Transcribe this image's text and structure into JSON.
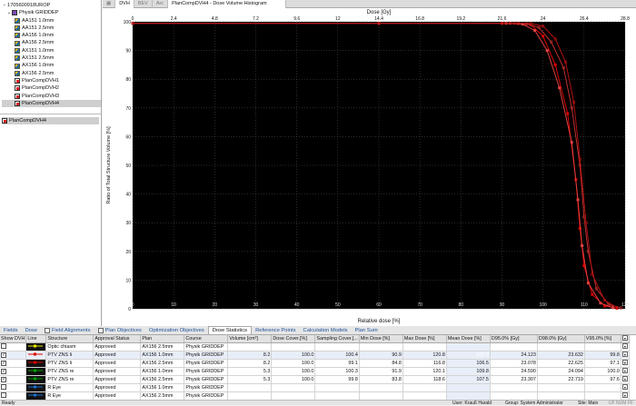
{
  "tree": {
    "patient": "1705600918UROP",
    "course": "Physik GRIDDEP",
    "plans": [
      "AA151 1.0mm",
      "AA151 2.5mm",
      "AA156 1.0mm",
      "AA156 2.5mm",
      "AX151 1.0mm",
      "AX151 2.5mm",
      "AX156 1.0mm",
      "AX156 2.5mm"
    ],
    "comps": [
      "PlanCompDVH1",
      "PlanCompDVH2",
      "PlanCompDVH3",
      "PlanCompDVH4"
    ],
    "selected_item": "PlanCompDVH4"
  },
  "topbar": {
    "buttons": [
      "DVH",
      "BEV",
      "Arc"
    ],
    "active_title": "PlanCompDVH4 - Dose Volume Histogram"
  },
  "chart_data": {
    "type": "line",
    "top_axis_label": "Dose [Gy]",
    "xlabel": "Relative dose [%]",
    "ylabel": "Ratio of Total Structure Volume [%]",
    "xlim": [
      0,
      120
    ],
    "ylim": [
      0,
      100
    ],
    "x_ticks": [
      0,
      10,
      20,
      30,
      40,
      50,
      60,
      70,
      80,
      90,
      100,
      110,
      120
    ],
    "y_ticks": [
      0,
      10,
      20,
      30,
      40,
      50,
      60,
      70,
      80,
      90,
      100
    ],
    "top_ticks": [
      "0",
      "2.4",
      "4.8",
      "7.2",
      "9.6",
      "12",
      "14.4",
      "16.8",
      "19.2",
      "21.6",
      "24",
      "26.4",
      "28.8"
    ],
    "grid": true,
    "series": [
      {
        "color": "#e00000",
        "points": [
          [
            0,
            99.5
          ],
          [
            60,
            99.5
          ],
          [
            90,
            99.5
          ],
          [
            94,
            99.4
          ],
          [
            97,
            99
          ],
          [
            100,
            95
          ],
          [
            103,
            85
          ],
          [
            106,
            68
          ],
          [
            108,
            45
          ],
          [
            109,
            28
          ],
          [
            110,
            15
          ],
          [
            112,
            5
          ],
          [
            115,
            1
          ],
          [
            118,
            0.2
          ]
        ]
      },
      {
        "color": "#c03030",
        "points": [
          [
            0,
            99.5
          ],
          [
            60,
            99.5
          ],
          [
            92,
            99.5
          ],
          [
            96,
            99.3
          ],
          [
            99,
            98
          ],
          [
            102,
            93
          ],
          [
            105,
            84
          ],
          [
            107,
            70
          ],
          [
            109,
            50
          ],
          [
            110,
            32
          ],
          [
            111,
            20
          ],
          [
            113,
            7
          ],
          [
            116,
            1.5
          ],
          [
            119,
            0.3
          ]
        ]
      },
      {
        "color": "#e04040",
        "points": [
          [
            0,
            99.5
          ],
          [
            60,
            99.5
          ],
          [
            91,
            99.5
          ],
          [
            95,
            99.2
          ],
          [
            98,
            97
          ],
          [
            101,
            90
          ],
          [
            104,
            77
          ],
          [
            107,
            58
          ],
          [
            108.5,
            38
          ],
          [
            109.5,
            22
          ],
          [
            111,
            9
          ],
          [
            114,
            2
          ],
          [
            117,
            0.4
          ]
        ]
      },
      {
        "color": "#b01010",
        "points": [
          [
            0,
            99.5
          ],
          [
            60,
            99.5
          ],
          [
            93,
            99.5
          ],
          [
            97,
            99.4
          ],
          [
            100,
            98.5
          ],
          [
            103,
            94
          ],
          [
            105.5,
            86
          ],
          [
            107.5,
            72
          ],
          [
            109,
            52
          ],
          [
            110.5,
            30
          ],
          [
            112,
            12
          ],
          [
            115,
            3
          ],
          [
            118,
            0.5
          ]
        ]
      }
    ]
  },
  "tabs": [
    {
      "label": "Fields",
      "check": false
    },
    {
      "label": "Dose",
      "check": false
    },
    {
      "label": "Field Alignments",
      "check": true
    },
    {
      "label": "Plan Objectives",
      "check": true
    },
    {
      "label": "Optimization Objectives",
      "check": false
    },
    {
      "label": "Dose Statistics",
      "check": false,
      "active": true
    },
    {
      "label": "Reference Points",
      "check": false
    },
    {
      "label": "Calculation Models",
      "check": false
    },
    {
      "label": "Plan Sum",
      "check": false
    }
  ],
  "table": {
    "headers": [
      "Show DVH",
      "Line",
      "Structure",
      "Approval Status",
      "Plan",
      "Course",
      "Volume [cm³]",
      "Dose Cover.[%]",
      "Sampling Cover.[...",
      "Min Dose [%]",
      "Max Dose [%]",
      "Mean Dose [%]",
      "D95.0% [Gy]",
      "D98.0% [Gy]",
      "V95.0% [%]"
    ],
    "rows": [
      {
        "show": false,
        "line": "#e8e800",
        "structure": "Optic chiasm",
        "approval": "Approved",
        "plan": "AX156 2.5mm",
        "course": "Physik GRIDDEP",
        "volume": "",
        "cover": "",
        "sampling": "",
        "min": "",
        "max": "",
        "mean": "",
        "d95": "",
        "d98": "",
        "v95": ""
      },
      {
        "show": true,
        "line": "#e00000",
        "structure": "PTV ZNS li",
        "approval": "Approved",
        "plan": "AX156 1.0mm",
        "course": "Physik GRIDDEP",
        "volume": "8.2",
        "cover": "100.0",
        "sampling": "100.4",
        "min": "90.9",
        "max": "120.8",
        "mean": "108.9",
        "d95": "24.123",
        "d98": "23.632",
        "v95": "99.8"
      },
      {
        "show": true,
        "line": "#e00000",
        "structure": "PTV ZNS li",
        "approval": "Approved",
        "plan": "AX156 2.5mm",
        "course": "Physik GRIDDEP",
        "volume": "8.2",
        "cover": "100.0",
        "sampling": "99.1",
        "min": "84.8",
        "max": "116.8",
        "mean": "106.5",
        "d95": "23.078",
        "d98": "22.625",
        "v95": "97.1"
      },
      {
        "show": true,
        "line": "#00a000",
        "structure": "PTV ZNS re",
        "approval": "Approved",
        "plan": "AX156 1.0mm",
        "course": "Physik GRIDDEP",
        "volume": "5.3",
        "cover": "100.0",
        "sampling": "100.3",
        "min": "91.9",
        "max": "120.1",
        "mean": "109.8",
        "d95": "24.590",
        "d98": "24.094",
        "v95": "100.0"
      },
      {
        "show": true,
        "line": "#00a000",
        "structure": "PTV ZNS re",
        "approval": "Approved",
        "plan": "AX156 2.5mm",
        "course": "Physik GRIDDEP",
        "volume": "5.3",
        "cover": "100.0",
        "sampling": "99.8",
        "min": "83.8",
        "max": "118.6",
        "mean": "107.5",
        "d95": "23.307",
        "d98": "22.719",
        "v95": "97.6"
      },
      {
        "show": false,
        "line": "#1e6fd0",
        "structure": "R Eye",
        "approval": "Approved",
        "plan": "AX156 1.0mm",
        "course": "Physik GRIDDEP",
        "volume": "",
        "cover": "",
        "sampling": "",
        "min": "",
        "max": "",
        "mean": "",
        "d95": "",
        "d98": "",
        "v95": ""
      },
      {
        "show": false,
        "line": "#1e6fd0",
        "structure": "R Eye",
        "approval": "Approved",
        "plan": "AX156 2.5mm",
        "course": "Physik GRIDDEP",
        "volume": "",
        "cover": "",
        "sampling": "",
        "min": "",
        "max": "",
        "mean": "",
        "d95": "",
        "d98": "",
        "v95": ""
      }
    ]
  },
  "status": {
    "left": "Ready",
    "user": "User: Krauß Harald",
    "group": "Group: System Administrator",
    "site": "Site: Main",
    "flags": "UF NUM FF"
  }
}
